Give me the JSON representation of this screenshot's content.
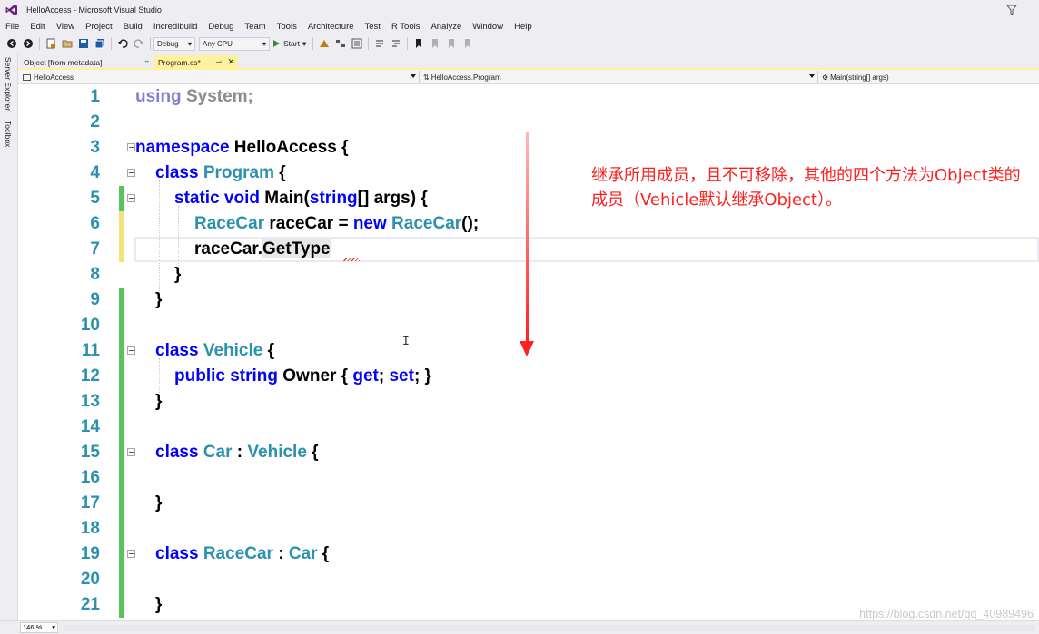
{
  "window": {
    "title": "HelloAccess - Microsoft Visual Studio"
  },
  "menu": [
    "File",
    "Edit",
    "View",
    "Project",
    "Build",
    "Incredibuild",
    "Debug",
    "Team",
    "Tools",
    "Architecture",
    "Test",
    "R Tools",
    "Analyze",
    "Window",
    "Help"
  ],
  "toolbar": {
    "config": "Debug",
    "platform": "Any CPU",
    "start_label": "Start"
  },
  "sidebar": {
    "server_explorer": "Server Explorer",
    "toolbox": "Toolbox"
  },
  "tabs": [
    {
      "label": "Object [from metadata]",
      "active": false
    },
    {
      "label": "Program.cs*",
      "active": true
    }
  ],
  "navbar": {
    "project": "HelloAccess",
    "type": "HelloAccess.Program",
    "member": "Main(string[] args)"
  },
  "editor": {
    "line_numbers": [
      "1",
      "2",
      "3",
      "4",
      "5",
      "6",
      "7",
      "8",
      "9",
      "10",
      "11",
      "12",
      "13",
      "14",
      "15",
      "16",
      "17",
      "18",
      "19",
      "20",
      "21"
    ],
    "code": {
      "l1_using": "using",
      "l1_system": " System;",
      "l3_ns": "namespace",
      "l3_name": " HelloAccess {",
      "l4_class": "class",
      "l4_name": " Program",
      "l4_brace": " {",
      "l5_static": "static void",
      "l5_main": " Main(",
      "l5_string": "string",
      "l5_rest": "[] args) {",
      "l6_type": "RaceCar",
      "l6_mid": " raceCar = ",
      "l6_new": "new",
      "l6_type2": " RaceCar",
      "l6_end": "();",
      "l7_obj": "raceCar.",
      "l7_member": "GetType",
      "l8": "}",
      "l9": "}",
      "l11_class": "class",
      "l11_name": " Vehicle",
      "l11_brace": " {",
      "l12_public": "public string",
      "l12_owner": " Owner { ",
      "l12_get": "get",
      "l12_semi": "; ",
      "l12_set": "set",
      "l12_end": "; }",
      "l13": "}",
      "l15_class": "class",
      "l15_name": " Car",
      "l15_colon": " : ",
      "l15_base": "Vehicle",
      "l15_brace": " {",
      "l17": "}",
      "l19_class": "class",
      "l19_name": " RaceCar",
      "l19_colon": " : ",
      "l19_base": "Car",
      "l19_brace": " {",
      "l21": "}"
    },
    "zoom": "146 %"
  },
  "annotation": "继承所用成员，且不可移除，其他的四个方法为Object类的成员（Vehicle默认继承Object）。",
  "watermark": "https://blog.csdn.net/qq_40989496",
  "colors": {
    "keyword": "#0000ff",
    "type": "#2b91af",
    "annotation": "#ff1f1f",
    "changed_saved": "#57c35b",
    "changed_unsaved": "#f4e27a"
  }
}
